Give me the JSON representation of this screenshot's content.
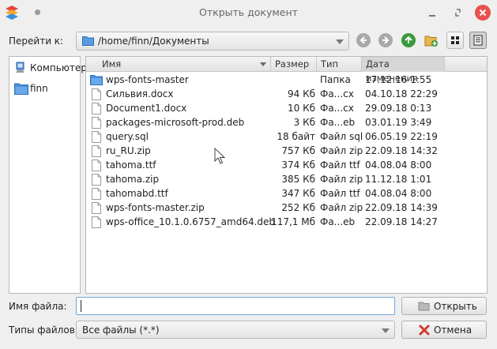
{
  "window": {
    "title": "Открыть документ"
  },
  "navigation": {
    "goto_label": "Перейти к:",
    "current_path": "/home/finn/Документы"
  },
  "places": [
    {
      "label": "Компьютер",
      "icon": "computer-icon"
    },
    {
      "label": "finn",
      "icon": "folder-icon"
    }
  ],
  "file_list": {
    "columns": {
      "name": "Имя",
      "size": "Размер",
      "type": "Тип",
      "date": "Дата изменения"
    },
    "rows": [
      {
        "name": "wps-fonts-master",
        "size": "",
        "type": "Папка",
        "date": "17.12.16 1:55",
        "icon": "folder-icon"
      },
      {
        "name": "Сильвия.docx",
        "size": "94 Кб",
        "type": "Фа...сх",
        "date": "04.10.18 22:29",
        "icon": "file-icon"
      },
      {
        "name": "Document1.docx",
        "size": "10 Кб",
        "type": "Фа...сх",
        "date": "29.09.18 0:13",
        "icon": "file-icon"
      },
      {
        "name": "packages-microsoft-prod.deb",
        "size": "3 Кб",
        "type": "Фа...eb",
        "date": "03.01.19 3:49",
        "icon": "file-icon"
      },
      {
        "name": "query.sql",
        "size": "18 байт",
        "type": "Файл sql",
        "date": "06.05.19 22:19",
        "icon": "file-icon"
      },
      {
        "name": "ru_RU.zip",
        "size": "757 Кб",
        "type": "Файл zip",
        "date": "22.09.18 14:32",
        "icon": "file-icon"
      },
      {
        "name": "tahoma.ttf",
        "size": "374 Кб",
        "type": "Файл ttf",
        "date": "04.08.04 8:00",
        "icon": "file-icon"
      },
      {
        "name": "tahoma.zip",
        "size": "385 Кб",
        "type": "Файл zip",
        "date": "11.12.18 1:01",
        "icon": "file-icon"
      },
      {
        "name": "tahomabd.ttf",
        "size": "347 Кб",
        "type": "Файл ttf",
        "date": "04.08.04 8:00",
        "icon": "file-icon"
      },
      {
        "name": "wps-fonts-master.zip",
        "size": "252 Кб",
        "type": "Файл zip",
        "date": "22.09.18 14:39",
        "icon": "file-icon"
      },
      {
        "name": "wps-office_10.1.0.6757_amd64.deb",
        "size": "117,1 Мб",
        "type": "Фа...eb",
        "date": "22.09.18 14:27",
        "icon": "file-icon"
      }
    ]
  },
  "filename": {
    "label": "Имя файла:",
    "value": ""
  },
  "filetype": {
    "label": "Типы файлов:",
    "selected": "Все файлы (*.*)"
  },
  "buttons": {
    "open": "Открыть",
    "cancel": "Отмена"
  },
  "colors": {
    "close_button": "#e8504e",
    "up_arrow": "#3a9a3a",
    "folder": "#4a8fd8"
  }
}
